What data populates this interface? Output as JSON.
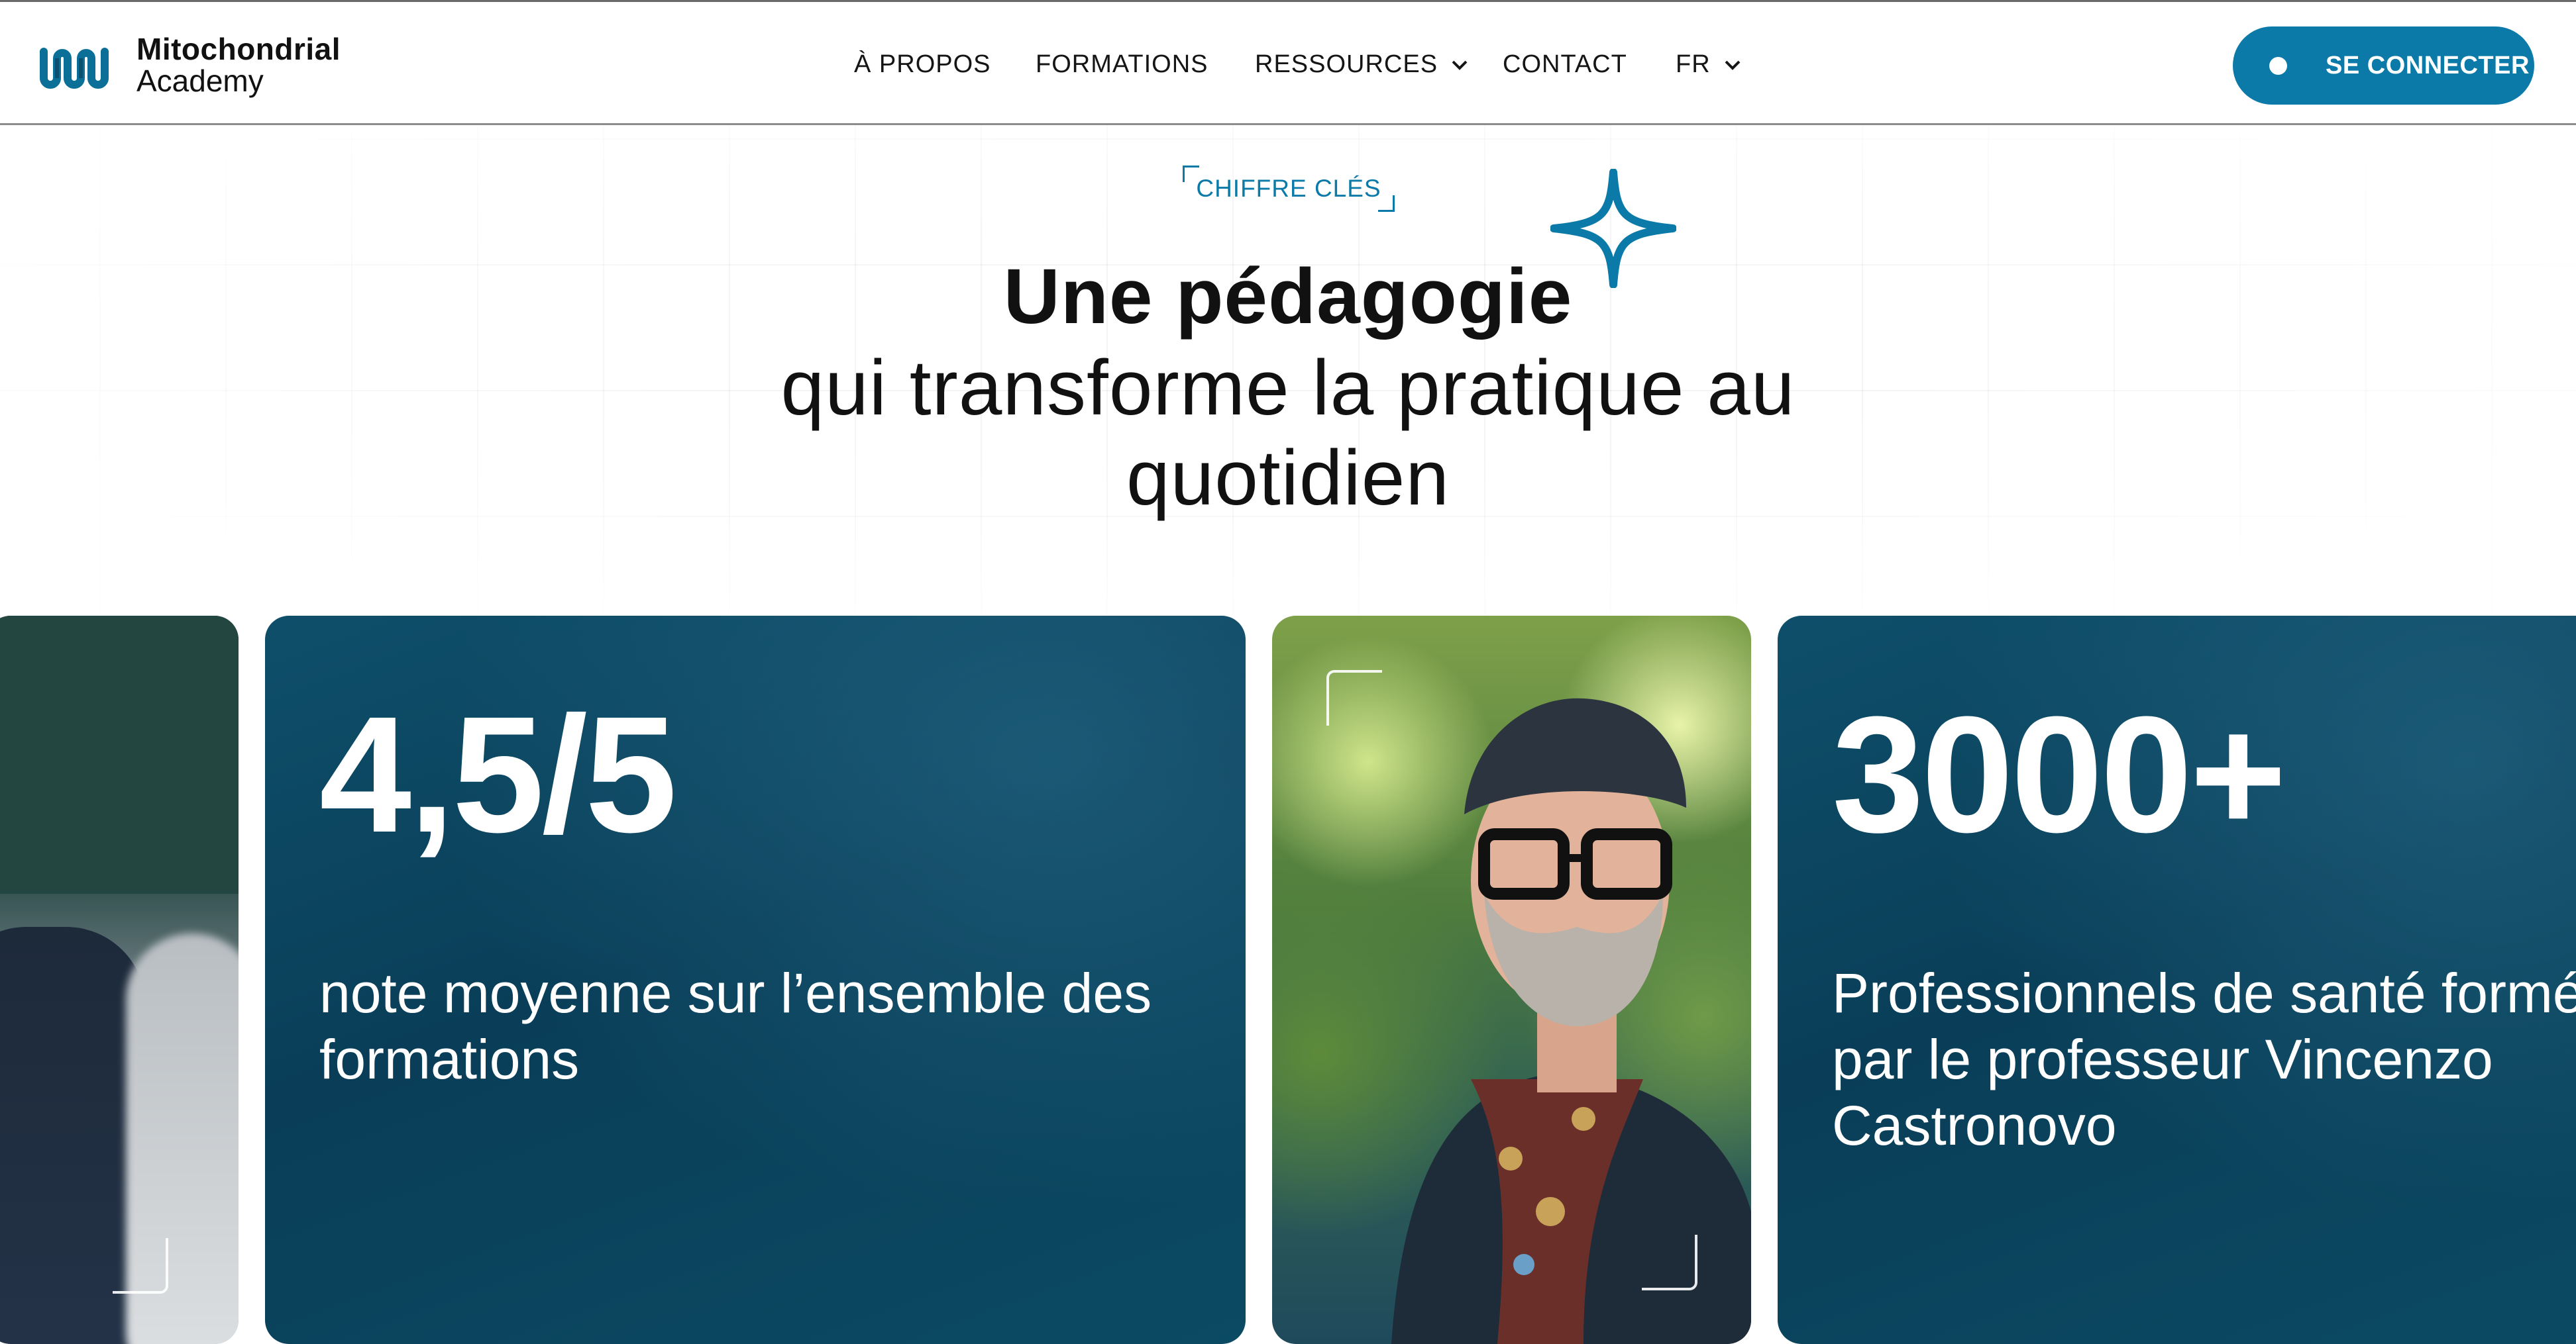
{
  "header": {
    "logo_line1": "Mitochondrial",
    "logo_line2": "Academy",
    "nav": [
      {
        "label": "À PROPOS",
        "has_dropdown": false
      },
      {
        "label": "FORMATIONS",
        "has_dropdown": false
      },
      {
        "label": "RESSOURCES",
        "has_dropdown": true
      },
      {
        "label": "CONTACT",
        "has_dropdown": false
      },
      {
        "label": "FR",
        "has_dropdown": true
      }
    ],
    "login_label": "SE CONNECTER"
  },
  "hero": {
    "eyebrow": "CHIFFRE CLÉS",
    "title_bold": "Une pédagogie",
    "title_rest_line1": "qui transforme la pratique au",
    "title_rest_line2": "quotidien"
  },
  "cards": [
    {
      "value": "4,5/5",
      "description_line1": "note moyenne sur l’ensemble des",
      "description_line2": "formations"
    },
    {
      "value": "3000+",
      "description_line1": "Professionnels de santé formés",
      "description_line2": "par le professeur Vincenzo",
      "description_line3": "Castronovo"
    }
  ],
  "colors": {
    "accent": "#0b7aa8",
    "card_bg": "#0a3e58",
    "text_dark": "#111111",
    "white": "#ffffff"
  },
  "icons": [
    "logo-mark-icon",
    "chevron-down-icon",
    "sparkle-star-icon"
  ]
}
